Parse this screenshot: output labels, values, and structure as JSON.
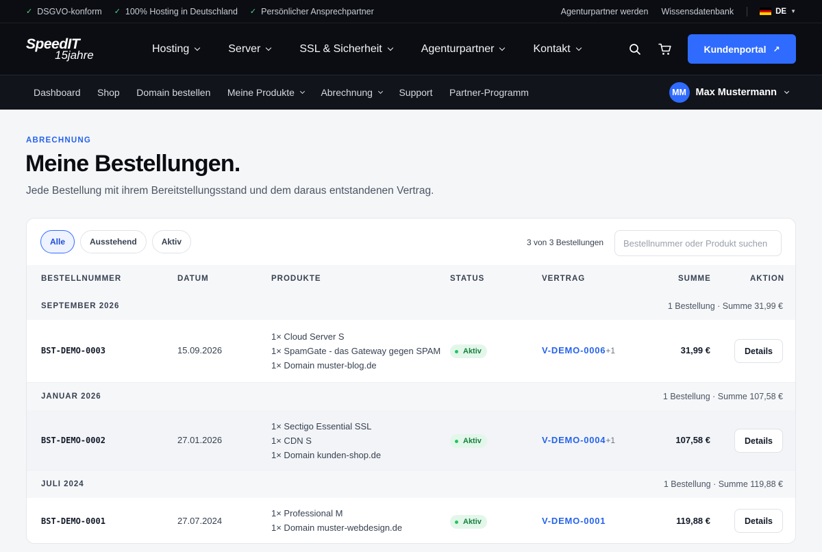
{
  "topbar": {
    "features": [
      "DSGVO-konform",
      "100% Hosting in Deutschland",
      "Persönlicher Ansprechpartner"
    ],
    "links": [
      "Agenturpartner werden",
      "Wissensdatenbank"
    ],
    "language": "DE"
  },
  "brand": {
    "name": "SpeedIT",
    "tagline": "15jahre"
  },
  "mainnav": {
    "items": [
      "Hosting",
      "Server",
      "SSL & Sicherheit",
      "Agenturpartner",
      "Kontakt"
    ],
    "cta": "Kundenportal"
  },
  "subnav": {
    "items": [
      "Dashboard",
      "Shop",
      "Domain bestellen",
      "Meine Produkte",
      "Abrechnung",
      "Support",
      "Partner-Programm"
    ],
    "user_initials": "MM",
    "user_name": "Max Mustermann"
  },
  "header": {
    "eyebrow": "ABRECHNUNG",
    "title": "Meine Bestellungen.",
    "subtitle": "Jede Bestellung mit ihrem Bereitstellungsstand und dem daraus entstandenen Vertrag."
  },
  "filters": [
    "Alle",
    "Ausstehend",
    "Aktiv"
  ],
  "count_text": "3 von 3 Bestellungen",
  "search_placeholder": "Bestellnummer oder Produkt suchen",
  "columns": [
    "BESTELLNUMMER",
    "DATUM",
    "PRODUKTE",
    "STATUS",
    "VERTRAG",
    "SUMME",
    "AKTION"
  ],
  "groups": [
    {
      "label": "SEPTEMBER 2026",
      "summary": "1 Bestellung · Summe 31,99 €",
      "order": {
        "number": "BST-DEMO-0003",
        "date": "15.09.2026",
        "products": [
          "1× Cloud Server S",
          "1× SpamGate - das Gateway gegen SPAM",
          "1× Domain muster-blog.de"
        ],
        "status": "Aktiv",
        "contract": "V-DEMO-0006",
        "contract_extra": "+1",
        "sum": "31,99 €",
        "action": "Details"
      }
    },
    {
      "label": "JANUAR 2026",
      "summary": "1 Bestellung · Summe 107,58 €",
      "order": {
        "number": "BST-DEMO-0002",
        "date": "27.01.2026",
        "products": [
          "1× Sectigo Essential SSL",
          "1× CDN S",
          "1× Domain kunden-shop.de"
        ],
        "status": "Aktiv",
        "contract": "V-DEMO-0004",
        "contract_extra": "+1",
        "sum": "107,58 €",
        "action": "Details"
      }
    },
    {
      "label": "JULI 2024",
      "summary": "1 Bestellung · Summe 119,88 €",
      "order": {
        "number": "BST-DEMO-0001",
        "date": "27.07.2024",
        "products": [
          "1× Professional M",
          "1× Domain muster-webdesign.de"
        ],
        "status": "Aktiv",
        "contract": "V-DEMO-0001",
        "contract_extra": "",
        "sum": "119,88 €",
        "action": "Details"
      }
    }
  ],
  "colors": {
    "accent": "#2f6bff",
    "link": "#2563eb",
    "status_active": "#15803d",
    "dark_bg": "#0b0d12"
  }
}
